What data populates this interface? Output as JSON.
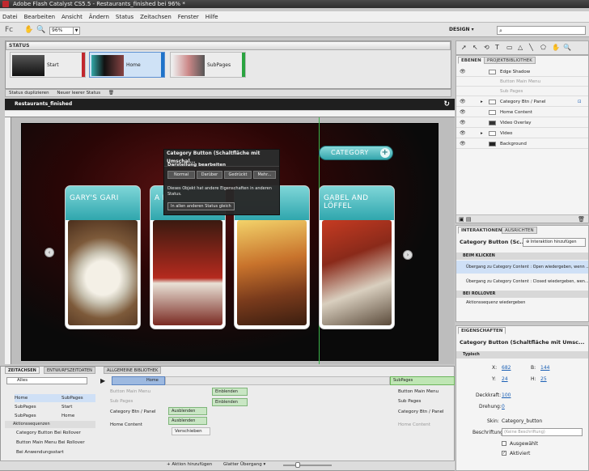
{
  "window": {
    "title": "Adobe Flash Catalyst CS5.5 - Restaurants_finished bei 96% *"
  },
  "menu": [
    "Datei",
    "Bearbeiten",
    "Ansicht",
    "Ändern",
    "Status",
    "Zeitachsen",
    "Fenster",
    "Hilfe"
  ],
  "toolbar": {
    "zoom": "96%",
    "workspace": "DESIGN"
  },
  "status_panel": {
    "title": "STATUS",
    "states": [
      {
        "label": "Start",
        "color": "#c1272d"
      },
      {
        "label": "Home",
        "color": "#1f73c9"
      },
      {
        "label": "SubPages",
        "color": "#2aa440"
      }
    ],
    "actions": [
      "Status duplizieren",
      "Neuer leerer Status"
    ]
  },
  "document": {
    "title": "Restaurants_finished"
  },
  "cards": [
    {
      "title": "GARY'S GARI"
    },
    {
      "title": "A F"
    },
    {
      "title": ""
    },
    {
      "title": "GABEL AND LÖFFEL"
    }
  ],
  "category_button": {
    "label": "CATEGORY"
  },
  "popup": {
    "title": "Category Button (Schaltfläche mit Umschal...",
    "subtitle": "Darstellung bearbeiten",
    "buttons": [
      "Normal",
      "Darüber",
      "Gedrückt",
      "Mehr..."
    ],
    "note": "Dieses Objekt hat andere Eigenschaften in anderen Status.",
    "link": "In allen anderen Status gleich"
  },
  "layers": {
    "tabs": [
      "EBENEN",
      "PROJEKTBIBLIOTHEK"
    ],
    "rows": [
      {
        "label": "Edge Shadow",
        "level": 1
      },
      {
        "label": "Button Main Menu",
        "level": 1,
        "dim": true
      },
      {
        "label": "Sub Pages",
        "level": 1,
        "dim": true
      },
      {
        "label": "Category Btn / Panel",
        "level": 1,
        "expander": true
      },
      {
        "label": "Home Content",
        "level": 1
      },
      {
        "label": "Video Overlay",
        "level": 1
      },
      {
        "label": "Video",
        "level": 1,
        "expander": true
      },
      {
        "label": "Background",
        "level": 1
      }
    ]
  },
  "interactions": {
    "tabs": [
      "INTERAKTIONEN",
      "AUSRICHTEN"
    ],
    "title": "Category Button (Sc...",
    "add_button": "Interaktion hinzufügen",
    "section_click": "BEIM KLICKEN",
    "click_items": [
      "Übergang zu Category Content : Open wiedergeben, wenn ...",
      "Übergang zu Category Content : Closed wiedergeben, wen..."
    ],
    "section_rollover": "BEI ROLLOVER",
    "rollover_item": "Aktionssequenz wiedergeben"
  },
  "properties": {
    "tab": "EIGENSCHAFTEN",
    "title": "Category Button (Schaltfläche mit Umsc...",
    "section": "Typisch",
    "x_label": "X:",
    "x": "682",
    "y_label": "Y:",
    "y": "24",
    "w_label": "B:",
    "w": "144",
    "h_label": "H:",
    "h": "25",
    "opacity_label": "Deckkraft:",
    "opacity": "100",
    "rotation_label": "Drehung:",
    "rotation": "0",
    "skin_label": "Skin:",
    "skin": "Category_button",
    "label_label": "Beschriftung:",
    "label_placeholder": "(Keine Beschriftung)",
    "chk_selected": "Ausgewählt",
    "chk_enabled": "Aktiviert"
  },
  "timeline": {
    "tabs": [
      "ZEITACHSEN",
      "ENTWURFSZEITDATEN",
      "ALLGEMEINE BIBLIOTHEK"
    ],
    "filter": "Alles",
    "from": "Home",
    "to": "SubPages",
    "left_rows": [
      [
        "Home",
        "SubPages"
      ],
      [
        "SubPages",
        "Start"
      ],
      [
        "SubPages",
        "Home"
      ]
    ],
    "section_action": "Aktionssequenzen",
    "actions": [
      "Category Button Bei Rollover",
      "Button Main Menu Bei Rollover",
      "Bei Anwendungsstart"
    ],
    "tracks": [
      "Button Main Menu",
      "Sub Pages",
      "Category Btn / Panel",
      "Home Content"
    ],
    "blocks": [
      "Einblenden",
      "Einblenden",
      "Ausblenden",
      "Ausblenden",
      "Verschieben"
    ],
    "sub_rows": [
      "Button Main Menu",
      "Sub Pages",
      "Category Btn / Panel",
      "Home Content"
    ],
    "bottom": [
      "Aktion hinzufügen",
      "Glatter Übergang"
    ]
  }
}
